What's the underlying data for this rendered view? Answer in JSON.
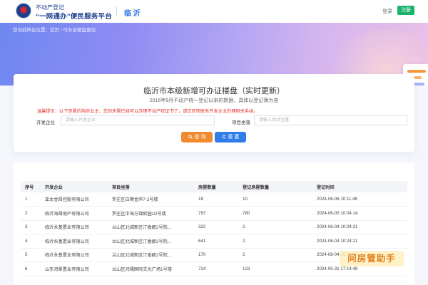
{
  "header": {
    "logo_line1": "不动产登记",
    "logo_line2": "“一网通办”便民服务平台",
    "city": "临 沂",
    "login_label": "登录",
    "register_label": "注册"
  },
  "breadcrumb": "您当前所在位置：首页 / 可办证楼盘查询",
  "search": {
    "title": "临沂市本级新增可办证楼盘（实时更新）",
    "subtitle": "2016年9月不动产统一登记以来的数据，具体以登记簿为准",
    "notice": "温馨提示：以下房屋的购房业主，您的房屋已经可以办理不动产权证书了，请您尽快联系开发企业办理相关手续。",
    "company_label": "开发企业",
    "company_placeholder": "请输入开发企业",
    "project_label": "项目坐落",
    "project_placeholder": "请输入项目坐落",
    "search_button": "查 询",
    "reset_button": "重 置"
  },
  "table": {
    "columns": [
      "序号",
      "开发企业",
      "项目坐落",
      "房屋数量",
      "登记房屋数量",
      "登记时间"
    ],
    "rows": [
      [
        "1",
        "亚太金昌控股有限公司",
        "罗庄区白鹭金岸7-2号楼",
        "18",
        "10",
        "2024-06-06 10:11:48"
      ],
      [
        "2",
        "临沂海晟地产有限公司",
        "罗庄区中海万锦熙园1D号楼",
        "797",
        "780",
        "2024-06-05 10:04:14"
      ],
      [
        "3",
        "临沂永基置业有限公司",
        "兰山区北城新区汀香郡2号院...",
        "322",
        "2",
        "2024-06-04 10:24:21"
      ],
      [
        "4",
        "临沂永基置业有限公司",
        "兰山区北城新区汀香郡2号院...",
        "641",
        "2",
        "2024-06-04 10:24:21"
      ],
      [
        "5",
        "临沂永基置业有限公司",
        "兰山区北城新区汀香郡2号院...",
        "170",
        "2",
        "2024-06-04 10:24:21"
      ],
      [
        "6",
        "山东鸿景置业有限公司",
        "兰山区鸿儒国际文化广场1号楼",
        "724",
        "123",
        "2024-05-31 17:14:48"
      ]
    ]
  },
  "watermark": "问房管助手",
  "colors": {
    "brand_blue": "#1d3f8c",
    "accent_blue": "#2f7de8",
    "search_orange": "#f28b2f",
    "register_green": "#1ab36b",
    "notice_red": "#e2352e"
  }
}
